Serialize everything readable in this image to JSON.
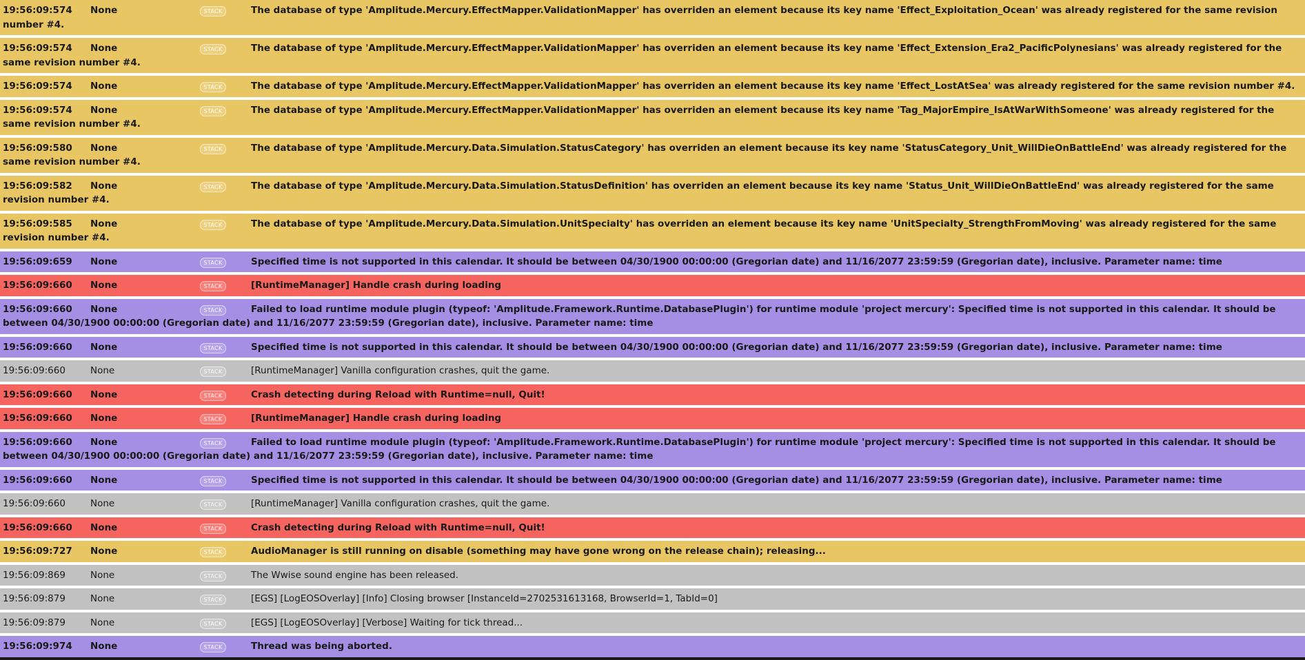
{
  "stack_label": "STACK",
  "level_colors": {
    "warning": "#e8c664",
    "info": "#a48fe5",
    "error": "#f6645f",
    "log": "#c1c1c1"
  },
  "rows": [
    {
      "time": "19:56:09:574",
      "category": "None",
      "level": "warning",
      "bold": true,
      "message": "The database of type 'Amplitude.Mercury.EffectMapper.ValidationMapper' has overriden an element because its key name 'Effect_Exploitation_Ocean' was already registered for the same revision number #4."
    },
    {
      "time": "19:56:09:574",
      "category": "None",
      "level": "warning",
      "bold": true,
      "message": "The database of type 'Amplitude.Mercury.EffectMapper.ValidationMapper' has overriden an element because its key name 'Effect_Extension_Era2_PacificPolynesians' was already registered for the same revision number #4."
    },
    {
      "time": "19:56:09:574",
      "category": "None",
      "level": "warning",
      "bold": true,
      "message": "The database of type 'Amplitude.Mercury.EffectMapper.ValidationMapper' has overriden an element because its key name 'Effect_LostAtSea' was already registered for the same revision number #4."
    },
    {
      "time": "19:56:09:574",
      "category": "None",
      "level": "warning",
      "bold": true,
      "message": "The database of type 'Amplitude.Mercury.EffectMapper.ValidationMapper' has overriden an element because its key name 'Tag_MajorEmpire_IsAtWarWithSomeone' was already registered for the same revision number #4."
    },
    {
      "time": "19:56:09:580",
      "category": "None",
      "level": "warning",
      "bold": true,
      "message": "The database of type 'Amplitude.Mercury.Data.Simulation.StatusCategory' has overriden an element because its key name 'StatusCategory_Unit_WillDieOnBattleEnd' was already registered for the same revision number #4."
    },
    {
      "time": "19:56:09:582",
      "category": "None",
      "level": "warning",
      "bold": true,
      "message": "The database of type 'Amplitude.Mercury.Data.Simulation.StatusDefinition' has overriden an element because its key name 'Status_Unit_WillDieOnBattleEnd' was already registered for the same revision number #4."
    },
    {
      "time": "19:56:09:585",
      "category": "None",
      "level": "warning",
      "bold": true,
      "message": "The database of type 'Amplitude.Mercury.Data.Simulation.UnitSpecialty' has overriden an element because its key name 'UnitSpecialty_StrengthFromMoving' was already registered for the same revision number #4."
    },
    {
      "time": "19:56:09:659",
      "category": "None",
      "level": "info",
      "bold": true,
      "message": "Specified time is not supported in this calendar. It should be between 04/30/1900 00:00:00 (Gregorian date) and 11/16/2077 23:59:59 (Gregorian date), inclusive. Parameter name: time"
    },
    {
      "time": "19:56:09:660",
      "category": "None",
      "level": "error",
      "bold": true,
      "message": "[RuntimeManager] Handle crash during loading"
    },
    {
      "time": "19:56:09:660",
      "category": "None",
      "level": "info",
      "bold": true,
      "message": "Failed to load runtime module plugin (typeof: 'Amplitude.Framework.Runtime.DatabasePlugin') for runtime module 'project mercury': Specified time is not supported in this calendar. It should be between 04/30/1900 00:00:00 (Gregorian date) and 11/16/2077 23:59:59 (Gregorian date), inclusive. Parameter name: time"
    },
    {
      "time": "19:56:09:660",
      "category": "None",
      "level": "info",
      "bold": true,
      "message": "Specified time is not supported in this calendar. It should be between 04/30/1900 00:00:00 (Gregorian date) and 11/16/2077 23:59:59 (Gregorian date), inclusive. Parameter name: time"
    },
    {
      "time": "19:56:09:660",
      "category": "None",
      "level": "log",
      "bold": false,
      "message": "[RuntimeManager] Vanilla configuration crashes, quit the game."
    },
    {
      "time": "19:56:09:660",
      "category": "None",
      "level": "error",
      "bold": true,
      "message": "Crash detecting during Reload with Runtime=null, Quit!"
    },
    {
      "time": "19:56:09:660",
      "category": "None",
      "level": "error",
      "bold": true,
      "message": "[RuntimeManager] Handle crash during loading"
    },
    {
      "time": "19:56:09:660",
      "category": "None",
      "level": "info",
      "bold": true,
      "message": "Failed to load runtime module plugin (typeof: 'Amplitude.Framework.Runtime.DatabasePlugin') for runtime module 'project mercury': Specified time is not supported in this calendar. It should be between 04/30/1900 00:00:00 (Gregorian date) and 11/16/2077 23:59:59 (Gregorian date), inclusive. Parameter name: time"
    },
    {
      "time": "19:56:09:660",
      "category": "None",
      "level": "info",
      "bold": true,
      "message": "Specified time is not supported in this calendar. It should be between 04/30/1900 00:00:00 (Gregorian date) and 11/16/2077 23:59:59 (Gregorian date), inclusive. Parameter name: time"
    },
    {
      "time": "19:56:09:660",
      "category": "None",
      "level": "log",
      "bold": false,
      "message": "[RuntimeManager] Vanilla configuration crashes, quit the game."
    },
    {
      "time": "19:56:09:660",
      "category": "None",
      "level": "error",
      "bold": true,
      "message": "Crash detecting during Reload with Runtime=null, Quit!"
    },
    {
      "time": "19:56:09:727",
      "category": "None",
      "level": "warning",
      "bold": true,
      "message": "AudioManager is still running on disable (something may have gone wrong on the release chain); releasing..."
    },
    {
      "time": "19:56:09:869",
      "category": "None",
      "level": "log",
      "bold": false,
      "message": "The Wwise sound engine has been released."
    },
    {
      "time": "19:56:09:879",
      "category": "None",
      "level": "log",
      "bold": false,
      "message": "[EGS] [LogEOSOverlay] [Info] Closing browser [InstanceId=2702531613168, BrowserId=1, TabId=0]"
    },
    {
      "time": "19:56:09:879",
      "category": "None",
      "level": "log",
      "bold": false,
      "message": "[EGS] [LogEOSOverlay] [Verbose] Waiting for tick thread..."
    },
    {
      "time": "19:56:09:974",
      "category": "None",
      "level": "info",
      "bold": true,
      "message": "Thread was being aborted."
    }
  ]
}
